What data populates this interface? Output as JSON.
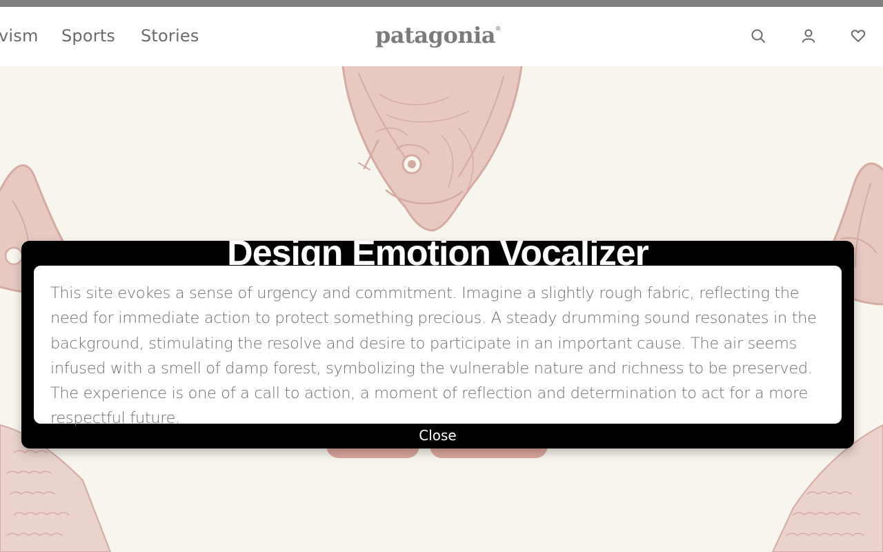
{
  "header": {
    "nav": [
      "vism",
      "Sports",
      "Stories"
    ],
    "logo": "patagonia",
    "icons": [
      "search-icon",
      "account-icon",
      "wishlist-heart-icon"
    ]
  },
  "hero": {
    "illustration": "fish-line-art",
    "illustration_color": "#d5aaa3",
    "background_color": "#f8f5ee"
  },
  "modal": {
    "title": "Design Emotion Vocalizer",
    "body": "This site evokes a sense of urgency and commitment. Imagine a slightly rough fabric, reflecting the need for immediate action to protect something precious. A steady drumming sound resonates in the background, stimulating the resolve and desire to participate in an important cause. The air seems infused with a smell of damp forest, symbolizing the vulnerable nature and richness to be preserved. The experience is one of a call to action, a moment of reflection and determination to act for a more respectful future.",
    "close_label": "Close"
  },
  "colors": {
    "header_bg": "#ffffff",
    "top_strip": "#7f7f7f",
    "nav_text": "#6a6a6a",
    "modal_bg": "#000000",
    "modal_body_text": "#6d6d6d",
    "pill": "#dba79d"
  }
}
